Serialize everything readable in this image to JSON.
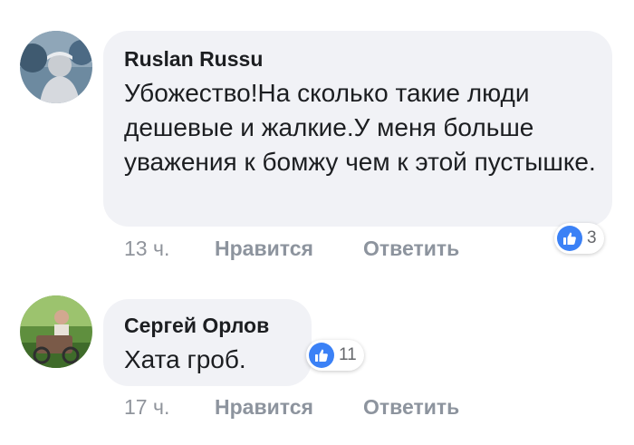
{
  "comments": [
    {
      "author": "Ruslan Russu",
      "text": "Убожество!На сколько такие люди дешевые и жалкие.У меня больше уважения к бомжу чем к этой пустышке.",
      "time": "13 ч.",
      "like_label": "Нравится",
      "reply_label": "Ответить",
      "reaction_count": "3",
      "reaction_icon": "like-thumb-icon"
    },
    {
      "author": "Сергей Орлов",
      "text": "Хата гроб.",
      "time": "17 ч.",
      "like_label": "Нравится",
      "reply_label": "Ответить",
      "reaction_count": "11",
      "reaction_icon": "like-thumb-icon"
    }
  ],
  "colors": {
    "bubble": "#f1f2f6",
    "like_blue": "#3b81f6",
    "meta_gray": "#8d949e"
  }
}
